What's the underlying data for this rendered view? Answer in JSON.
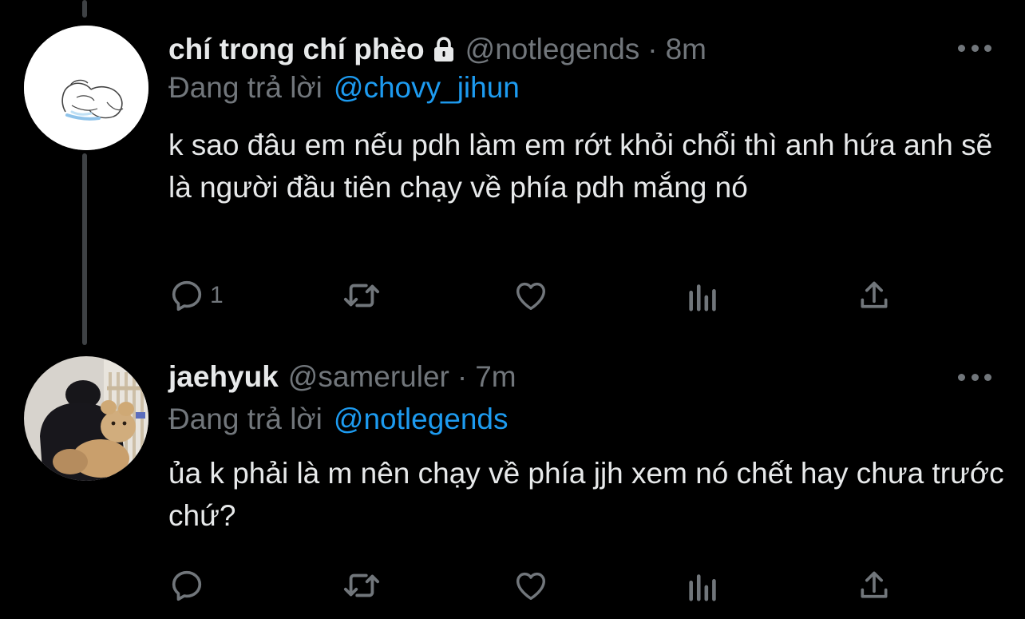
{
  "tweets": [
    {
      "name": "chí trong chí phèo",
      "protected": true,
      "handle": "@notlegends",
      "separator": "·",
      "time": "8m",
      "reply_label": "Đang trả lời",
      "reply_to": "@chovy_jihun",
      "text": "k sao đâu em nếu pdh làm em rớt khỏi chổi thì anh hứa anh sẽ là người đầu tiên chạy về phía pdh mắng nó",
      "reply_count": "1"
    },
    {
      "name": "jaehyuk",
      "protected": false,
      "handle": "@sameruler",
      "separator": "·",
      "time": "7m",
      "reply_label": "Đang trả lời",
      "reply_to": "@notlegends",
      "text": "ủa k phải là m nên chạy về phía jjh xem nó chết hay chưa trước chứ?",
      "reply_count": ""
    }
  ],
  "icons": {
    "lock": "lock-icon",
    "more": "more-icon",
    "reply": "reply-icon",
    "retweet": "retweet-icon",
    "like": "like-icon",
    "views": "views-icon",
    "share": "share-icon"
  },
  "colors": {
    "background": "#000000",
    "text": "#e7e9ea",
    "muted": "#71767b",
    "accent": "#1d9bf0",
    "thread_line": "#3e4144"
  }
}
